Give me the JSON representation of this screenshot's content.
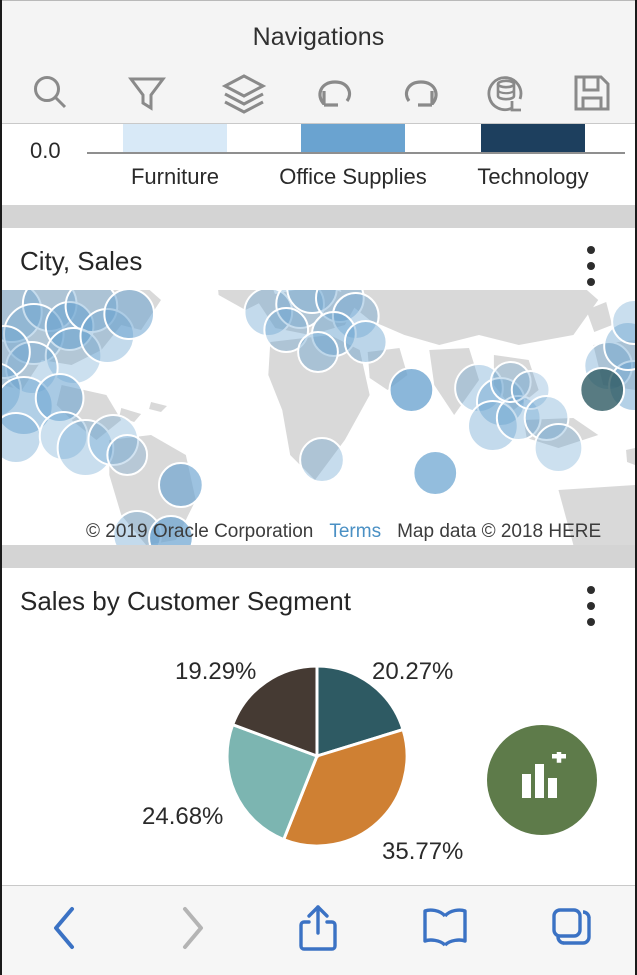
{
  "header": {
    "title": "Navigations",
    "toolbar": [
      {
        "name": "search-icon",
        "label": "Search"
      },
      {
        "name": "filter-icon",
        "label": "Filter"
      },
      {
        "name": "layers-icon",
        "label": "Layers"
      },
      {
        "name": "undo-icon",
        "label": "Undo"
      },
      {
        "name": "redo-icon",
        "label": "Redo"
      },
      {
        "name": "refresh-data-icon",
        "label": "Refresh Data"
      },
      {
        "name": "save-icon",
        "label": "Save"
      }
    ]
  },
  "bar_chart": {
    "axis_min_label": "0.0",
    "colors": [
      "#d8e9f7",
      "#6aa3d0",
      "#1d3f5e"
    ],
    "chart_data": {
      "type": "bar",
      "title": "",
      "xlabel": "",
      "ylabel": "",
      "categories": [
        "Furniture",
        "Office Supplies",
        "Technology"
      ],
      "values": [
        1,
        1,
        1
      ],
      "ylim": [
        0,
        1
      ],
      "grid": false,
      "note": "Only the lower portion of each bar is visible; chart is clipped by the viewport above."
    }
  },
  "map_card": {
    "title": "City, Sales",
    "menu_icon": "kebab-menu-icon",
    "attribution": {
      "copyright": "© 2019 Oracle Corporation",
      "terms": "Terms",
      "map_data": "Map data © 2018 HERE"
    },
    "bubble_color": "#6aa3d0"
  },
  "pie_card": {
    "title": "Sales by Customer Segment",
    "menu_icon": "kebab-menu-icon",
    "fab": {
      "icon": "add-chart-icon",
      "color": "#5e7b4a"
    },
    "chart_data": {
      "type": "pie",
      "title": "Sales by Customer Segment",
      "labels": [
        "20.27%",
        "35.77%",
        "24.68%",
        "19.29%"
      ],
      "values": [
        20.27,
        35.77,
        24.68,
        19.29
      ],
      "colors": [
        "#2e5a63",
        "#cf8033",
        "#7cb5b1",
        "#453a33"
      ],
      "legend": "none",
      "label_position": "outside"
    }
  },
  "browser_bar": {
    "items": [
      {
        "name": "back-button",
        "label": "Back",
        "enabled": true
      },
      {
        "name": "forward-button",
        "label": "Forward",
        "enabled": false
      },
      {
        "name": "share-button",
        "label": "Share",
        "enabled": true
      },
      {
        "name": "bookmarks-button",
        "label": "Bookmarks",
        "enabled": true
      },
      {
        "name": "tabs-button",
        "label": "Tabs",
        "enabled": true
      }
    ],
    "active_color": "#3b72c4",
    "disabled_color": "#b4b4b4"
  }
}
